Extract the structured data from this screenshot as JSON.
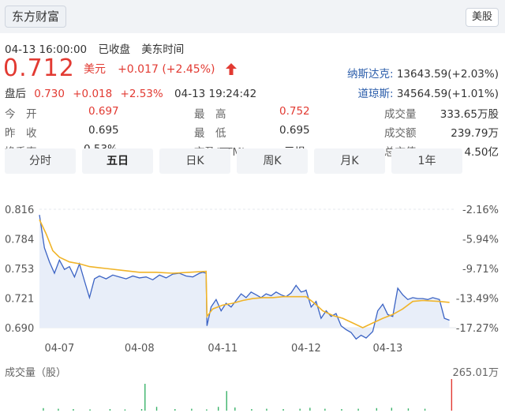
{
  "header": {
    "brand": "东方财富",
    "market": "美股"
  },
  "status": {
    "datetime": "04-13 16:00:00",
    "state": "已收盘",
    "tz": "美东时间"
  },
  "quote": {
    "price": "0.712",
    "currency": "美元",
    "change": "+0.017 (+2.45%)",
    "color_up": "#e23a32"
  },
  "after_hours": {
    "label": "盘后",
    "price": "0.730",
    "change": "+0.018",
    "pct": "+2.53%",
    "time": "04-13 19:24:42"
  },
  "indices": [
    {
      "name": "纳斯达克:",
      "value": "13643.59(+2.03%)"
    },
    {
      "name": "道琼斯:",
      "value": "34564.59(+1.01%)"
    }
  ],
  "stats": [
    {
      "label": "今　开",
      "value": "0.697",
      "tone": "red"
    },
    {
      "label": "最　高",
      "value": "0.752",
      "tone": "red"
    },
    {
      "label": "成交量",
      "value": "333.65万股",
      "tone": "blk"
    },
    {
      "label": "昨　收",
      "value": "0.695",
      "tone": "blk"
    },
    {
      "label": "最　低",
      "value": "0.695",
      "tone": "blk"
    },
    {
      "label": "成交额",
      "value": "239.79万",
      "tone": "blk"
    },
    {
      "label": "换手率",
      "value": "0.53%",
      "tone": "blk"
    },
    {
      "label": "市盈(TTM)",
      "value": "亏损",
      "tone": "blk"
    },
    {
      "label": "总市值",
      "value": "4.50亿",
      "tone": "blk"
    }
  ],
  "tabs": [
    "分时",
    "五日",
    "日K",
    "周K",
    "月K",
    "1年"
  ],
  "active_tab": "五日",
  "chart_data": {
    "type": "line",
    "yticks_left": [
      "0.816",
      "0.784",
      "0.753",
      "0.721",
      "0.690"
    ],
    "yticks_right": [
      "-2.16%",
      "-5.94%",
      "-9.71%",
      "-13.49%",
      "-17.27%"
    ],
    "ylim": [
      0.69,
      0.816
    ],
    "xticks": [
      "04-07",
      "04-08",
      "04-11",
      "04-12",
      "04-13"
    ],
    "series": [
      {
        "color": "#3b63c4",
        "points": [
          [
            0,
            0.81
          ],
          [
            0.3,
            0.775
          ],
          [
            0.6,
            0.76
          ],
          [
            0.9,
            0.748
          ],
          [
            1.2,
            0.762
          ],
          [
            1.5,
            0.752
          ],
          [
            1.8,
            0.755
          ],
          [
            2.1,
            0.744
          ],
          [
            2.4,
            0.758
          ],
          [
            2.7,
            0.74
          ],
          [
            3.0,
            0.722
          ],
          [
            3.3,
            0.742
          ],
          [
            3.6,
            0.745
          ],
          [
            4.0,
            0.742
          ],
          [
            4.4,
            0.746
          ],
          [
            4.8,
            0.744
          ],
          [
            5.2,
            0.742
          ],
          [
            5.6,
            0.745
          ],
          [
            6.0,
            0.743
          ],
          [
            6.4,
            0.744
          ],
          [
            6.8,
            0.741
          ],
          [
            7.2,
            0.746
          ],
          [
            7.6,
            0.743
          ],
          [
            8.0,
            0.747
          ],
          [
            8.4,
            0.748
          ],
          [
            8.8,
            0.745
          ],
          [
            9.2,
            0.744
          ],
          [
            9.6,
            0.748
          ],
          [
            9.8,
            0.749
          ],
          [
            10.0,
            0.748
          ],
          [
            10.05,
            0.692
          ],
          [
            10.3,
            0.712
          ],
          [
            10.6,
            0.72
          ],
          [
            10.9,
            0.708
          ],
          [
            11.2,
            0.716
          ],
          [
            11.5,
            0.712
          ],
          [
            11.8,
            0.719
          ],
          [
            12.1,
            0.726
          ],
          [
            12.4,
            0.722
          ],
          [
            12.7,
            0.728
          ],
          [
            13.0,
            0.725
          ],
          [
            13.3,
            0.722
          ],
          [
            13.6,
            0.726
          ],
          [
            13.9,
            0.724
          ],
          [
            14.2,
            0.728
          ],
          [
            14.5,
            0.725
          ],
          [
            14.8,
            0.723
          ],
          [
            15.1,
            0.727
          ],
          [
            15.4,
            0.735
          ],
          [
            15.7,
            0.728
          ],
          [
            15.9,
            0.729
          ],
          [
            16.0,
            0.73
          ],
          [
            16.3,
            0.712
          ],
          [
            16.6,
            0.718
          ],
          [
            16.9,
            0.7
          ],
          [
            17.2,
            0.708
          ],
          [
            17.5,
            0.702
          ],
          [
            17.8,
            0.705
          ],
          [
            18.1,
            0.692
          ],
          [
            18.4,
            0.688
          ],
          [
            18.7,
            0.685
          ],
          [
            19.0,
            0.678
          ],
          [
            19.3,
            0.682
          ],
          [
            19.6,
            0.679
          ],
          [
            20.0,
            0.686
          ],
          [
            20.3,
            0.708
          ],
          [
            20.6,
            0.715
          ],
          [
            20.9,
            0.704
          ],
          [
            21.2,
            0.702
          ],
          [
            21.5,
            0.732
          ],
          [
            21.8,
            0.725
          ],
          [
            22.1,
            0.72
          ],
          [
            22.4,
            0.722
          ],
          [
            22.7,
            0.721
          ],
          [
            23.0,
            0.721
          ],
          [
            23.3,
            0.72
          ],
          [
            23.6,
            0.722
          ],
          [
            24.0,
            0.72
          ],
          [
            24.3,
            0.7
          ],
          [
            24.6,
            0.698
          ]
        ]
      },
      {
        "color": "#f0b429",
        "points": [
          [
            0,
            0.805
          ],
          [
            0.4,
            0.79
          ],
          [
            0.8,
            0.772
          ],
          [
            1.2,
            0.765
          ],
          [
            1.8,
            0.76
          ],
          [
            2.4,
            0.758
          ],
          [
            3.0,
            0.755
          ],
          [
            4.0,
            0.753
          ],
          [
            5.0,
            0.751
          ],
          [
            6.0,
            0.749
          ],
          [
            7.0,
            0.749
          ],
          [
            8.0,
            0.748
          ],
          [
            9.0,
            0.749
          ],
          [
            10.0,
            0.75
          ],
          [
            10.05,
            0.702
          ],
          [
            10.4,
            0.71
          ],
          [
            11.0,
            0.714
          ],
          [
            11.6,
            0.716
          ],
          [
            12.2,
            0.719
          ],
          [
            12.8,
            0.721
          ],
          [
            13.4,
            0.722
          ],
          [
            14.0,
            0.722
          ],
          [
            14.6,
            0.723
          ],
          [
            15.2,
            0.723
          ],
          [
            16.0,
            0.723
          ],
          [
            16.5,
            0.716
          ],
          [
            17.0,
            0.708
          ],
          [
            17.6,
            0.703
          ],
          [
            18.2,
            0.7
          ],
          [
            18.8,
            0.695
          ],
          [
            19.4,
            0.69
          ],
          [
            20.0,
            0.695
          ],
          [
            20.6,
            0.7
          ],
          [
            21.2,
            0.704
          ],
          [
            21.8,
            0.71
          ],
          [
            22.4,
            0.718
          ],
          [
            23.0,
            0.719
          ],
          [
            24.0,
            0.718
          ],
          [
            24.6,
            0.717
          ]
        ]
      }
    ],
    "volume": {
      "label": "成交量（股）",
      "max_label": "265.01万",
      "bars": [
        [
          0.2,
          0.08
        ],
        [
          1.1,
          0.06
        ],
        [
          2.0,
          0.05
        ],
        [
          3.0,
          0.04
        ],
        [
          4.2,
          0.05
        ],
        [
          5.1,
          0.04
        ],
        [
          6.1,
          0.05
        ],
        [
          7.0,
          0.12
        ],
        [
          8.1,
          0.05
        ],
        [
          9.1,
          0.06
        ],
        [
          10.0,
          0.04
        ],
        [
          10.7,
          0.12
        ],
        [
          11.7,
          0.1
        ],
        [
          12.7,
          0.05
        ],
        [
          13.6,
          0.06
        ],
        [
          14.6,
          0.05
        ],
        [
          15.6,
          0.06
        ],
        [
          16.2,
          0.09
        ],
        [
          17.1,
          0.06
        ],
        [
          18.1,
          0.05
        ],
        [
          19.1,
          0.06
        ],
        [
          20.2,
          0.08
        ],
        [
          21.1,
          0.09
        ],
        [
          22.1,
          0.07
        ],
        [
          23.1,
          0.06
        ],
        [
          24.7,
          1.0
        ]
      ],
      "tall_bars": [
        [
          6.3,
          0.85
        ],
        [
          11.2,
          0.62
        ]
      ]
    }
  }
}
